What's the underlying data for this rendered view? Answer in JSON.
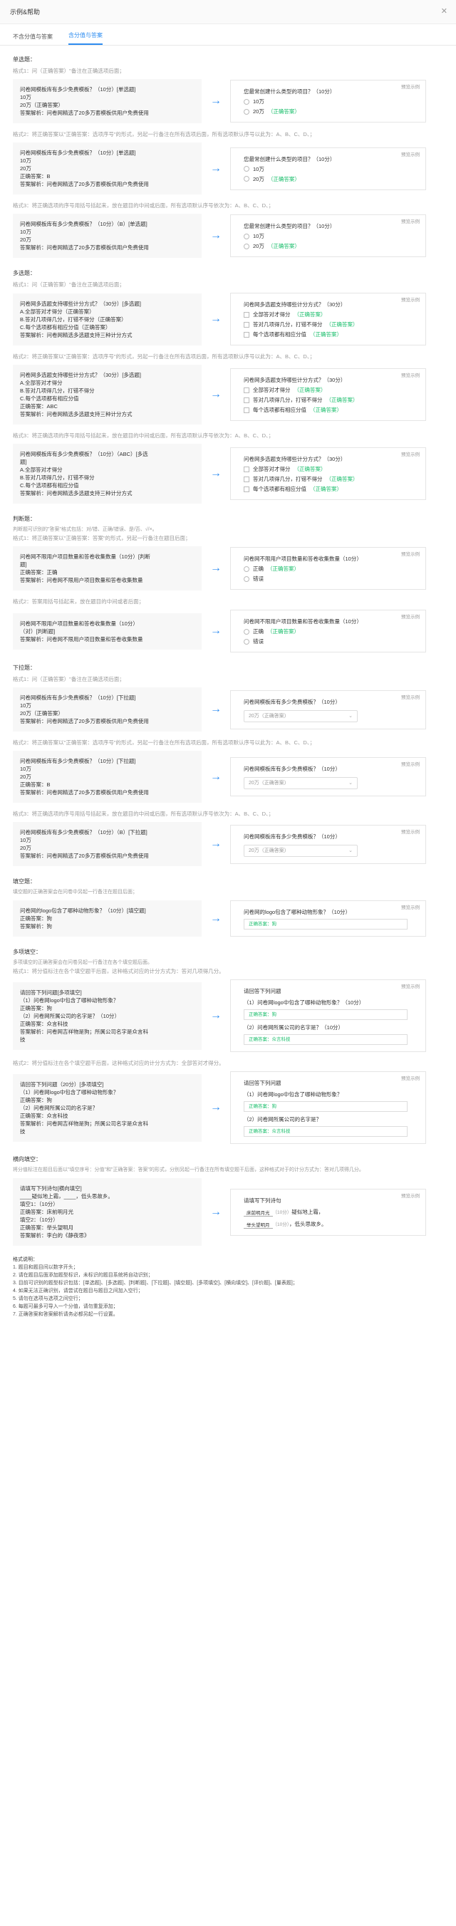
{
  "header": {
    "title": "示例&帮助"
  },
  "tabs": [
    {
      "label": "不含分值与答案"
    },
    {
      "label": "含分值与答案"
    }
  ],
  "preview_label": "预览示例",
  "sections": {
    "single": {
      "title": "单选题：",
      "f1": "格式1：问（正确答案）\"备注在正确选项后面；",
      "f1_left": [
        "问卷网模板库有多少免费模板？（10分）[单选题]",
        "10万",
        "20万（正确答案）",
        "答案解析：问卷网精选了20多万套模板供用户免费使用"
      ],
      "f2": "格式2：将正确答案以\"正确答案：选项序号\"的形式，另起一行备注在所有选项后面，所有选项默认序号以此为：A、B、C、D、；",
      "f2_left": [
        "问卷网模板库有多少免费模板？（10分）[单选题]",
        "10万",
        "20万",
        "正确答案：B",
        "答案解析：问卷网精选了20多万套模板供用户免费使用"
      ],
      "f3": "格式3：将正确选项的序号用括号括起来，放在题目的中间或后面，所有选项默认序号依次为：A、B、C、D、；",
      "f3_left": [
        "问卷网模板库有多少免费模板？（10分）（B）[单选题]",
        "10万",
        "20万",
        "答案解析：问卷网精选了20多万套模板供用户免费使用"
      ],
      "right_q": "您最常创建什么类型的项目？（10分）",
      "opt1": "10万",
      "opt2": "20万",
      "correct": "（正确答案）"
    },
    "multi": {
      "title": "多选题：",
      "f1": "格式1：问（正确答案）\"备注在正确选项后面；",
      "f1_left": [
        "问卷网多选题支持哪些计分方式？（30分）[多选题]",
        "A.全部答对才得分（正确答案）",
        "B.答对几项得几分，打错不得分（正确答案）",
        "C.每个选项都有相应分值（正确答案）",
        "答案解析：问卷网精选多选题支持三种计分方式"
      ],
      "f2": "格式2：将正确答案以\"正确答案：选项序号\"的形式，另起一行备注在所有选项后面，所有选项默认序号以此为：A、B、C、D、；",
      "f2_left": [
        "问卷网多选题支持哪些计分方式？（30分）[多选题]",
        "A.全部答对才得分",
        "B.答对几项得几分，打错不得分",
        "C.每个选项都有相应分值",
        "正确答案：ABC",
        "答案解析：问卷网精选多选题支持三种计分方式"
      ],
      "f3": "格式3：将正确选项的序号用括号括起来，放在题目的中间或后面，所有选项默认序号依次为：A、B、C、D、；",
      "f3_left": [
        "问卷网模板库有多少免费模板？（10分）（ABC）[多选",
        "题]",
        "A.全部答对才得分",
        "B.答对几项得几分，打错不得分",
        "C.每个选项都有相应分值",
        "答案解析：问卷网精选多选题支持三种计分方式"
      ],
      "right_q": "问卷网多选题支持哪些计分方式？（30分）",
      "opt1": "全部答对才得分",
      "opt2": "答对几项得几分，打错不得分",
      "opt3": "每个选项都有相应分值",
      "correct": "（正确答案）"
    },
    "judge": {
      "title": "判断题：",
      "note": "判断题可识别的\"答案\"格式包括：对/错、正确/错误、是/否、√/×。",
      "f1": "格式1：将正确答案以\"正确答案：答案\"的形式，另起一行备注在题目后面；",
      "f1_left": [
        "问卷网不限用户项目数量和答卷收集数量（10分）[判断",
        "题]",
        "正确答案：正确",
        "答案解析：问卷网不限用户项目数量和答卷收集数量"
      ],
      "f2": "格式2：答案用括号括起来，放在题目的中间或者后面；",
      "f2_left": [
        "问卷网不限用户项目数量和答卷收集数量（10分）",
        "（对）[判断题]",
        "答案解析：问卷网不限用户项目数量和答卷收集数量"
      ],
      "right_q": "问卷网不限用户项目数量和答卷收集数量（10分）",
      "opt1": "正确",
      "opt2": "错误",
      "correct": "（正确答案）"
    },
    "dropdown": {
      "title": "下拉题：",
      "f1": "格式1：问（正确答案）\"备注在正确选项后面；",
      "f1_left": [
        "问卷网模板库有多少免费模板？（10分）[下拉题]",
        "10万",
        "20万（正确答案）",
        "答案解析：问卷网精选了20多万套模板供用户免费使用"
      ],
      "f2": "格式2：将正确答案以\"正确答案：选项序号\"的形式，另起一行备注在所有选项后面，所有选项默认序号以此为：A、B、C、D、；",
      "f2_left": [
        "问卷网模板库有多少免费模板？（10分）[下拉题]",
        "10万",
        "20万",
        "正确答案：B",
        "答案解析：问卷网精选了20多万套模板供用户免费使用"
      ],
      "f3": "格式3：将正确选项的序号用括号括起来，放在题目的中间或后面，所有选项默认序号依次为：A、B、C、D、；",
      "f3_left": [
        "问卷网模板库有多少免费模板？（10分）（B）[下拉题]",
        "10万",
        "20万",
        "答案解析：问卷网精选了20多万套模板供用户免费使用"
      ],
      "right_q": "问卷网模板库有多少免费模板？（10分）",
      "select_value": "20万（正确答案）"
    },
    "fill": {
      "title": "填空题：",
      "note": "填空题的正确答案会在问卷中另起一行备注在题目后面；",
      "left": [
        "问卷网的logo包含了哪种动物形象？（10分）[填空题]",
        "正确答案：狗",
        "答案解析：狗"
      ],
      "right_q": "问卷网的logo包含了哪种动物形象？（10分）",
      "answer": "正确答案：狗"
    },
    "multifill": {
      "title": "多项填空：",
      "note": "多项填空的正确答案会在问卷另起一行备注在各个填空题后面。",
      "f1": "格式1：将分值标注在各个填空题干后面，这种格式对应的计分方式为：答对几项得几分。",
      "f1_left": [
        "请回答下列问题[多项填空]",
        "（1）问卷网logo中包含了哪种动物形象？",
        "正确答案：狗",
        "（2）问卷网所属公司的名字是？（10分）",
        "正确答案：众言科技",
        "答案解析：问卷网吉祥物是狗；所属公司名字是众言科",
        "技"
      ],
      "f2": "格式2：将分值标注在各个填空题干后面，这种格式对应的计分方式为：全部答对才得分。",
      "f2_left": [
        "请回答下列问题（20分）[多项填空]",
        "（1）问卷网logo中包含了哪种动物形象？",
        "正确答案：狗",
        "（2）问卷网所属公司的名字是？",
        "正确答案：众言科技",
        "答案解析：问卷网吉祥物是狗；所属公司名字是众言科",
        "技"
      ],
      "right_title": "请回答下列问题",
      "q1_1": "（1）问卷网logo中包含了哪种动物形象？（10分）",
      "q2_1": "（2）问卷网所属公司的名字是？（10分）",
      "q1_2": "（1）问卷网logo中包含了哪种动物形象？",
      "q2_2": "（2）问卷网所属公司的名字是？",
      "a1": "正确答案：狗",
      "a2": "正确答案：众言科技"
    },
    "hfill": {
      "title": "横向填空：",
      "note": "将分值标注在题目后面以\"填空序号：分值\"和\"正确答案：答案\"的形式，分别另起一行备注在所有填空题干后面，这种格式对于的计分方式为：答对几项得几分。",
      "left": [
        "请填写下列诗句[横向填空]",
        "____疑似地上霜，____，低头思故乡。",
        "填空1：（10分）",
        "正确答案：床前明月光",
        "填空2：（10分）",
        "正确答案：举头望明月",
        "答案解析：李白的《静夜思》"
      ],
      "right_title": "请填写下列诗句",
      "line1_pre": "床前明月光",
      "line1_post": "疑似地上霜，",
      "line2_pre": "举头望明月",
      "line2_post": "，低头思故乡。",
      "score": "（10分）"
    }
  },
  "footer": [
    "格式说明：",
    "1. 题目和题目间以数字开头；",
    "2. 请在题目后面添加题型标识，未标识的题目系统将自动识别；",
    "3. 目前可识别的题型标识包括：[单选题]、[多选题]、[判断题]、[下拉题]、[填空题]、[多项填空]、[横向填空]、[评价题]、[量表题]；",
    "4. 如果无法正确识别，请尝试在题目与题目之间加入空行；",
    "5. 请勿在选项与选项之间空行；",
    "6. 每题可最多可导入一个分值，请勿重复添加；",
    "7. 正确答案和答案解析请务必都另起一行设置。"
  ]
}
